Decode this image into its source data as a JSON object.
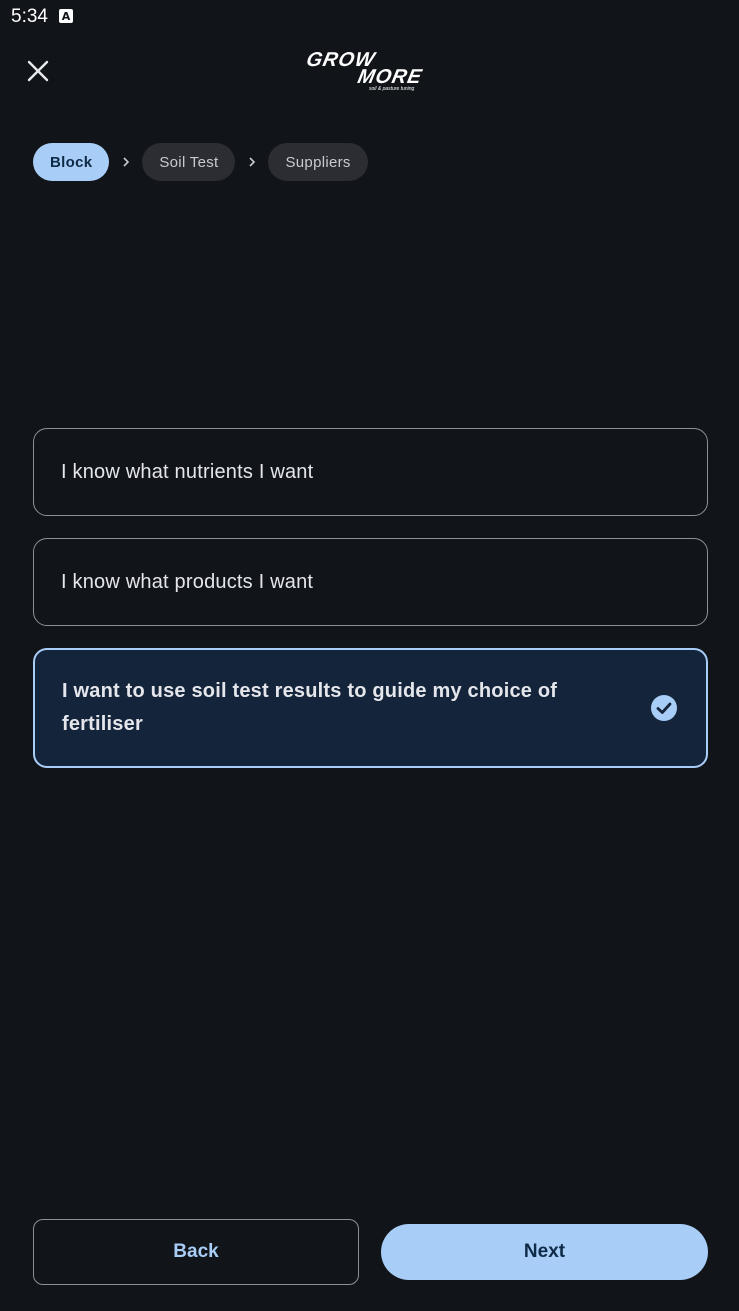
{
  "status_bar": {
    "time": "5:34",
    "notification_icon": "a-icon",
    "notification_letter": "A"
  },
  "header": {
    "close_icon": "close-icon",
    "logo_top": "GROW",
    "logo_bottom": "MORE",
    "logo_tagline": "soil & pasture tuning"
  },
  "breadcrumb": {
    "steps": [
      {
        "label": "Block",
        "active": true
      },
      {
        "label": "Soil Test",
        "active": false
      },
      {
        "label": "Suppliers",
        "active": false
      }
    ],
    "separator_icon": "chevron-right-icon"
  },
  "options": [
    {
      "label": "I know what nutrients I want",
      "selected": false
    },
    {
      "label": "I know what products I want",
      "selected": false
    },
    {
      "label": "I want to use soil test results to guide my choice of fertiliser",
      "selected": true
    }
  ],
  "footer": {
    "back_label": "Back",
    "next_label": "Next"
  },
  "colors": {
    "background": "#111419",
    "accent": "#a8cdf7",
    "accent_text": "#0f2a46",
    "selected_bg": "#14243a",
    "border": "#8e9097",
    "chip_inactive": "#2b2d33"
  }
}
